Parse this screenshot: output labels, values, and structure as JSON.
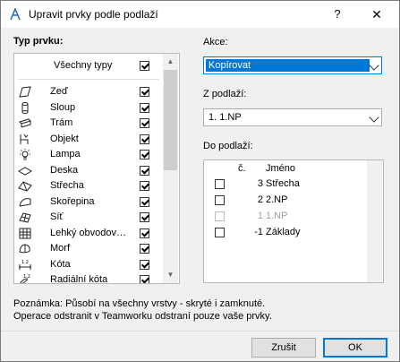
{
  "window": {
    "title": "Upravit prvky podle podlaží",
    "help_label": "?",
    "close_label": "✕"
  },
  "left": {
    "heading": "Typ prvku:",
    "all_label": "Všechny typy",
    "all_checked": true,
    "items": [
      {
        "label": "Zeď",
        "icon": "wall-icon",
        "checked": true
      },
      {
        "label": "Sloup",
        "icon": "column-icon",
        "checked": true
      },
      {
        "label": "Trám",
        "icon": "beam-icon",
        "checked": true
      },
      {
        "label": "Objekt",
        "icon": "object-icon",
        "checked": true
      },
      {
        "label": "Lampa",
        "icon": "lamp-icon",
        "checked": true
      },
      {
        "label": "Deska",
        "icon": "slab-icon",
        "checked": true
      },
      {
        "label": "Střecha",
        "icon": "roof-icon",
        "checked": true
      },
      {
        "label": "Skořepina",
        "icon": "shell-icon",
        "checked": true
      },
      {
        "label": "Síť",
        "icon": "mesh-icon",
        "checked": true
      },
      {
        "label": "Lehký obvodov…",
        "icon": "curtain-wall-icon",
        "checked": true
      },
      {
        "label": "Morf",
        "icon": "morph-icon",
        "checked": true
      },
      {
        "label": "Kóta",
        "icon": "dimension-icon",
        "checked": true
      },
      {
        "label": "Radiální kóta",
        "icon": "radial-dimension-icon",
        "checked": true
      }
    ]
  },
  "right": {
    "action_label": "Akce:",
    "action_value": "Kopírovat",
    "from_label": "Z podlaží:",
    "from_value": "1. 1.NP",
    "to_label": "Do podlaží:",
    "col_num": "č.",
    "col_name": "Jméno",
    "floors": [
      {
        "num": "3",
        "name": "Střecha",
        "checked": false,
        "disabled": false
      },
      {
        "num": "2",
        "name": "2.NP",
        "checked": false,
        "disabled": false
      },
      {
        "num": "1",
        "name": "1.NP",
        "checked": false,
        "disabled": true
      },
      {
        "num": "-1",
        "name": "Základy",
        "checked": false,
        "disabled": false
      }
    ]
  },
  "note": {
    "line1": "Poznámka: Působí na všechny vrstvy - skryté i zamknuté.",
    "line2": "Operace odstranit v Teamworku odstraní pouze vaše prvky."
  },
  "buttons": {
    "cancel": "Zrušit",
    "ok": "OK"
  },
  "colors": {
    "accent": "#0078d7",
    "selection_bg": "#0078d7",
    "border": "#b8b8b8"
  }
}
